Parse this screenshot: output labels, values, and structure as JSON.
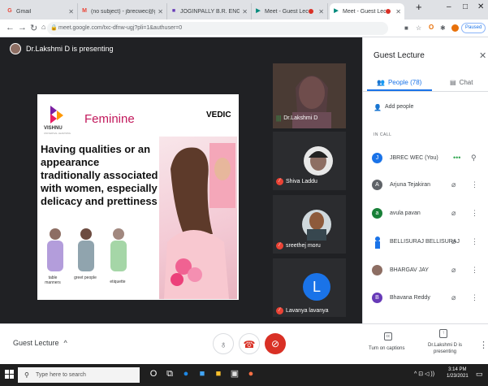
{
  "browser": {
    "tabs": [
      {
        "label": "Gmail",
        "favicon": "G",
        "color": "#ea4335"
      },
      {
        "label": "(no subject) - jbrecwec@gmail",
        "favicon": "M",
        "color": "#ea4335"
      },
      {
        "label": "JOGINPALLY B.R. ENGINEERING",
        "favicon": "■",
        "color": "#673ab7"
      },
      {
        "label": "Meet - Guest Lecture",
        "favicon": "▶",
        "color": "#00897b"
      },
      {
        "label": "Meet - Guest Lecture",
        "favicon": "▶",
        "color": "#00897b"
      }
    ],
    "new_tab": "+",
    "url": "meet.google.com/txc-dfnw-ugj?pli=1&authuser=0",
    "paused_label": "Paused",
    "win_min": "–",
    "win_max": "□",
    "win_close": "✕"
  },
  "meeting": {
    "presenter_banner": "Dr.Lakshmi D is presenting",
    "slide": {
      "title": "Feminine",
      "brand_right": "VEDIC",
      "logo_name": "VISHNU",
      "logo_sub": "UNIVERSAL LEARNING",
      "body": "Having qualities or an appearance traditionally associated with women, especially delicacy and prettiness",
      "figure_labels": [
        "table manners",
        "greet people",
        "etiquette"
      ]
    },
    "tiles": [
      {
        "name": "Dr.Lakshmi D"
      },
      {
        "name": "Shiva Laddu"
      },
      {
        "name": "sreethej moru"
      },
      {
        "name": "Lavanya lavanya",
        "initial": "L"
      }
    ],
    "meeting_title": "Guest Lecture",
    "caption_label": "Turn on captions",
    "presenting_label": "Dr.Lakshmi D is presenting"
  },
  "panel": {
    "title": "Guest Lecture",
    "tab_people": "People (78)",
    "tab_chat": "Chat",
    "add_people": "Add people",
    "section": "IN CALL",
    "people": [
      {
        "name": "JBREC WEC (You)",
        "initial": "J",
        "color": "#1a73e8"
      },
      {
        "name": "Arjuna Tejakiran",
        "initial": "A",
        "color": "#5f6368"
      },
      {
        "name": "avula pavan",
        "initial": "a",
        "color": "#188038"
      },
      {
        "name": "BELLISURAJ BELLISURAJ",
        "initial": "",
        "color": "#1a73e8"
      },
      {
        "name": "BHARGAV JAY",
        "initial": "",
        "color": "#8d6e63"
      },
      {
        "name": "Bhavana Reddy",
        "initial": "B",
        "color": "#673ab7"
      }
    ]
  },
  "taskbar": {
    "search_placeholder": "Type here to search",
    "time": "3:14 PM",
    "date": "1/23/2021"
  }
}
